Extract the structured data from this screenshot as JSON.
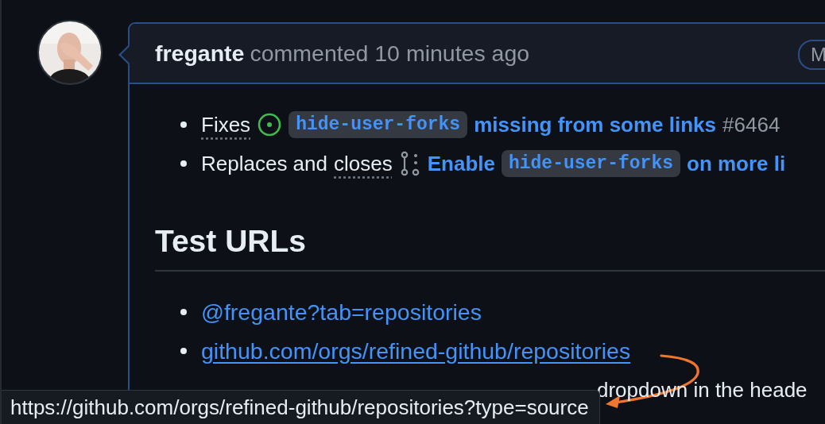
{
  "comment": {
    "author": "fregante",
    "action": "commented 10 minutes ago",
    "badge": "M"
  },
  "fixes": [
    {
      "parts": [
        {
          "kind": "keyword",
          "text": "Fixes"
        },
        {
          "kind": "issue-icon"
        },
        {
          "kind": "code",
          "text": "hide-user-forks"
        },
        {
          "kind": "link",
          "text": "missing from some links"
        },
        {
          "kind": "ref",
          "text": "#6464"
        }
      ]
    },
    {
      "parts": [
        {
          "kind": "text",
          "text": "Replaces and"
        },
        {
          "kind": "keyword",
          "text": "closes"
        },
        {
          "kind": "pr-icon"
        },
        {
          "kind": "link",
          "text": "Enable"
        },
        {
          "kind": "code",
          "text": "hide-user-forks"
        },
        {
          "kind": "link",
          "text": "on more li"
        }
      ]
    }
  ],
  "heading": "Test URLs",
  "test_urls": [
    {
      "kind": "link",
      "text": "@fregante?tab=repositories",
      "hovered": false
    },
    {
      "kind": "link",
      "text": "github.com/orgs/refined-github/repositories",
      "hovered": true
    },
    {
      "kind": "covered",
      "text": "dropdown in the heade"
    }
  ],
  "status_bar": {
    "url": "https://github.com/orgs/refined-github/repositories?type=source"
  }
}
